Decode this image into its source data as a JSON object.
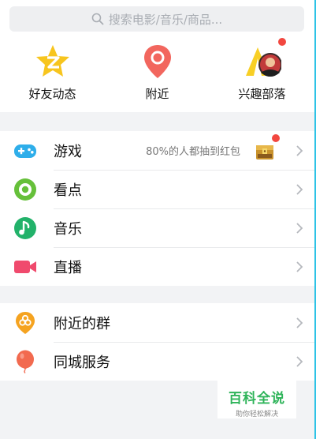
{
  "search": {
    "placeholder": "搜索电影/音乐/商品..."
  },
  "quick_actions": [
    {
      "label": "好友动态",
      "icon": "qzone-star-icon"
    },
    {
      "label": "附近",
      "icon": "location-pin-icon"
    },
    {
      "label": "兴趣部落",
      "icon": "tribe-tent-icon",
      "badge": true
    }
  ],
  "group1": [
    {
      "label": "游戏",
      "icon": "gamepad-icon",
      "hint": "80%的人都抽到红包",
      "badge": true
    },
    {
      "label": "看点",
      "icon": "eye-icon"
    },
    {
      "label": "音乐",
      "icon": "music-note-icon"
    },
    {
      "label": "直播",
      "icon": "video-camera-icon"
    }
  ],
  "group2": [
    {
      "label": "附近的群",
      "icon": "nearby-group-icon"
    },
    {
      "label": "同城服务",
      "icon": "balloon-icon"
    }
  ],
  "watermark": {
    "title": "百科全说",
    "subtitle": "助你轻松解决"
  },
  "colors": {
    "accent_cyan": "#2ec3e6",
    "badge_red": "#f2473f",
    "game_blue": "#2eaeea",
    "eye_green": "#66c03a",
    "music_green": "#22b26a",
    "live_pink": "#f04a6d",
    "group_orange": "#f5a320",
    "balloon_red": "#f26a4f"
  }
}
